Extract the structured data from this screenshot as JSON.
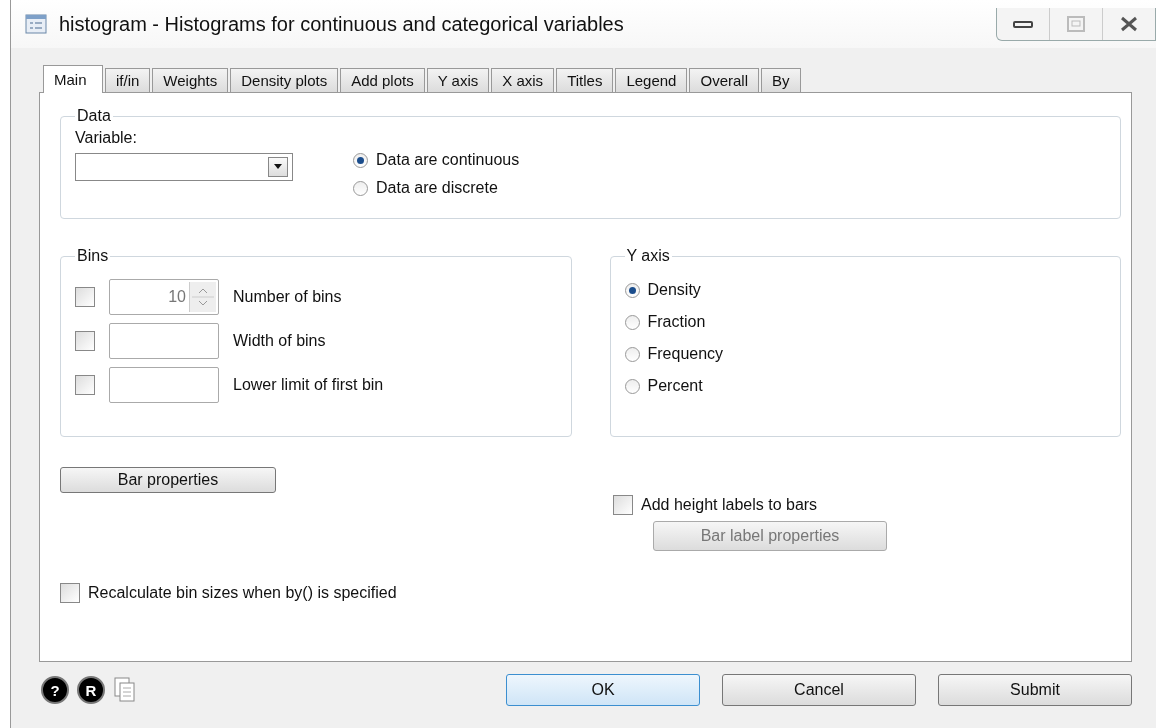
{
  "window": {
    "title": "histogram - Histograms for continuous and categorical variables"
  },
  "tabs": [
    {
      "label": "Main",
      "selected": true
    },
    {
      "label": "if/in",
      "selected": false
    },
    {
      "label": "Weights",
      "selected": false
    },
    {
      "label": "Density plots",
      "selected": false
    },
    {
      "label": "Add plots",
      "selected": false
    },
    {
      "label": "Y axis",
      "selected": false
    },
    {
      "label": "X axis",
      "selected": false
    },
    {
      "label": "Titles",
      "selected": false
    },
    {
      "label": "Legend",
      "selected": false
    },
    {
      "label": "Overall",
      "selected": false
    },
    {
      "label": "By",
      "selected": false
    }
  ],
  "data_group": {
    "legend": "Data",
    "variable_label": "Variable:",
    "data_type": [
      {
        "label": "Data are continuous",
        "selected": true
      },
      {
        "label": "Data are discrete",
        "selected": false
      }
    ]
  },
  "bins_group": {
    "legend": "Bins",
    "rows": [
      {
        "kind": "spinner",
        "checked": false,
        "value": "10",
        "label": "Number of bins"
      },
      {
        "kind": "text",
        "checked": false,
        "label": "Width of bins"
      },
      {
        "kind": "text",
        "checked": false,
        "label": "Lower limit of first bin"
      }
    ]
  },
  "y_axis_group": {
    "legend": "Y axis",
    "options": [
      {
        "label": "Density",
        "selected": true
      },
      {
        "label": "Fraction",
        "selected": false
      },
      {
        "label": "Frequency",
        "selected": false
      },
      {
        "label": "Percent",
        "selected": false
      }
    ]
  },
  "bar_properties_button": {
    "label": "Bar properties"
  },
  "height_labels": {
    "label": "Add height labels to bars",
    "checked": false
  },
  "bar_label_properties_button": {
    "label": "Bar label properties",
    "disabled": true
  },
  "recalculate": {
    "label": "Recalculate bin sizes when by() is specified",
    "checked": false
  },
  "footer": {
    "help": "?",
    "reset": "R",
    "buttons": [
      {
        "label": "OK",
        "default": true
      },
      {
        "label": "Cancel",
        "default": false
      },
      {
        "label": "Submit",
        "default": false
      }
    ]
  }
}
